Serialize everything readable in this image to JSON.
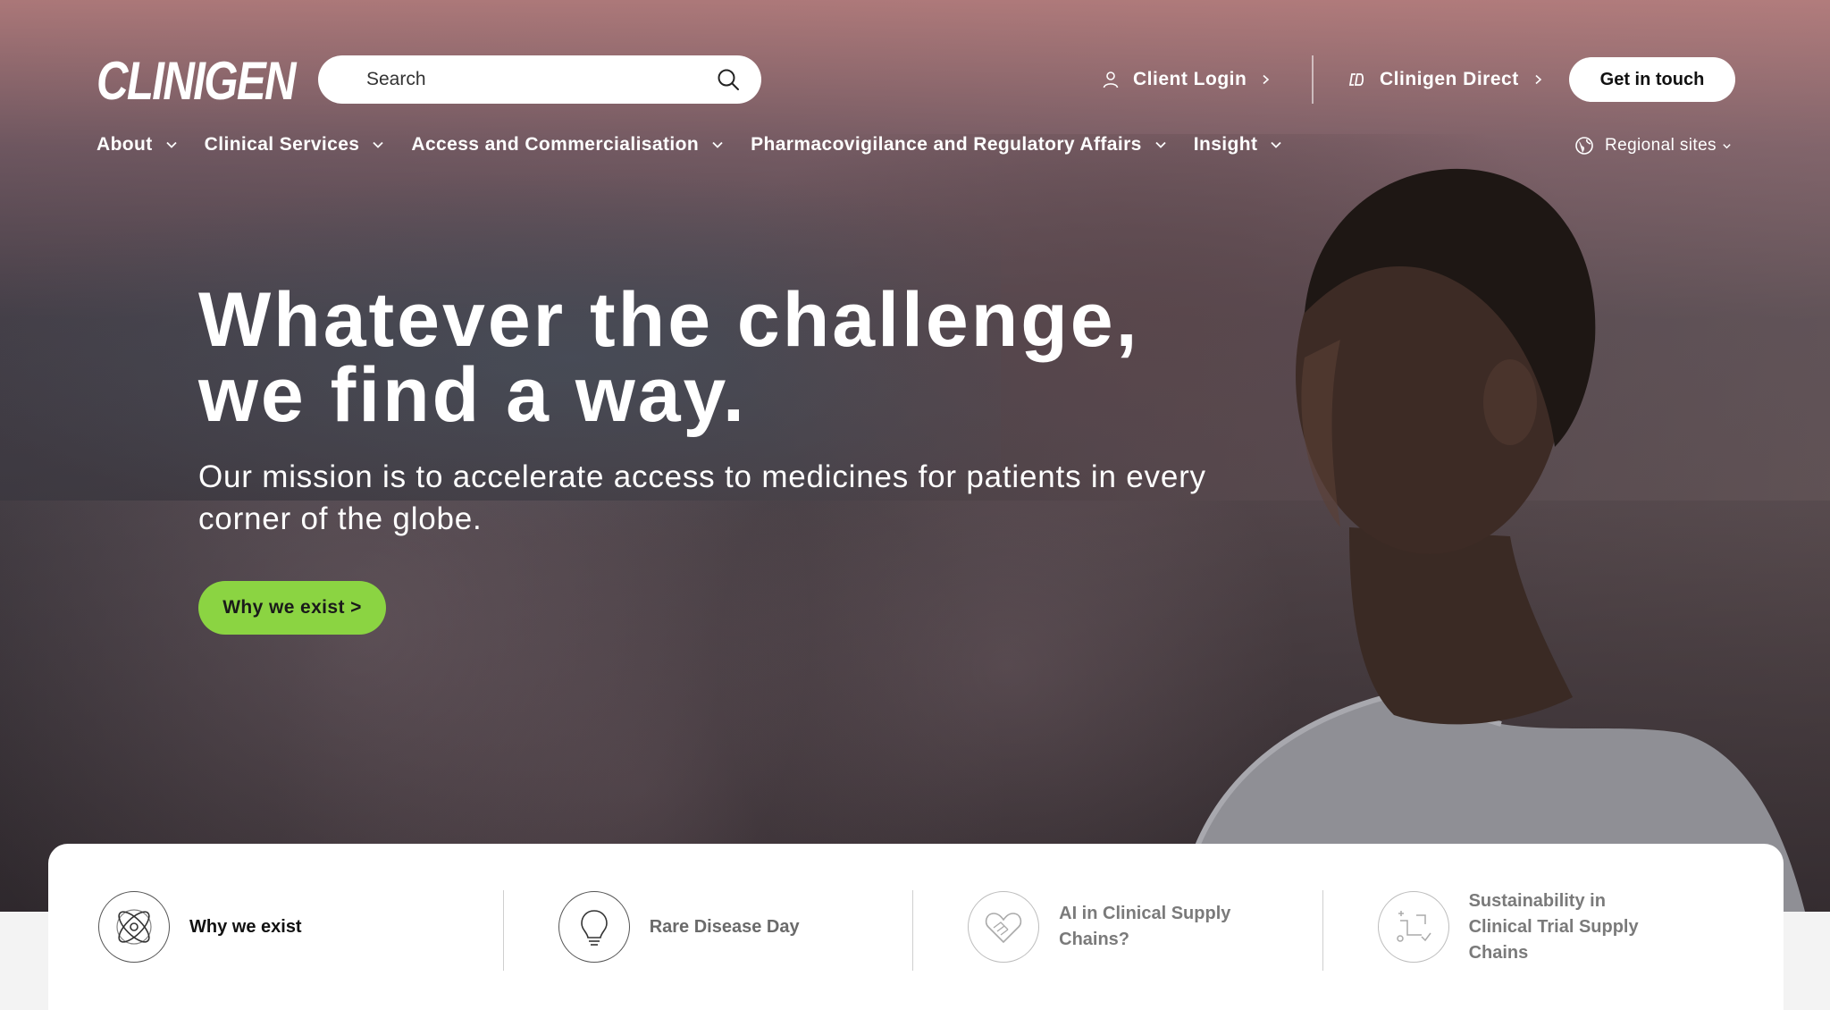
{
  "header": {
    "logo_text": "CLINIGEN",
    "search_placeholder": "Search",
    "client_login_label": "Client Login",
    "clinigen_direct_label": "Clinigen Direct",
    "get_in_touch_label": "Get in touch"
  },
  "nav": {
    "items": [
      {
        "label": "About"
      },
      {
        "label": "Clinical Services"
      },
      {
        "label": "Access and Commercialisation"
      },
      {
        "label": "Pharmacovigilance and Regulatory Affairs"
      },
      {
        "label": "Insight"
      }
    ],
    "regional_label": "Regional sites"
  },
  "hero": {
    "headline_line1": "Whatever the challenge,",
    "headline_line2": "we find a way.",
    "subhead": "Our mission is to accelerate access to medicines for patients in every corner of the globe.",
    "cta_label": "Why we exist >"
  },
  "cards": [
    {
      "label": "Why we exist",
      "icon": "atom-icon"
    },
    {
      "label": "Rare Disease Day",
      "icon": "lightbulb-icon"
    },
    {
      "label": "AI in Clinical Supply Chains?",
      "icon": "handshake-heart-icon"
    },
    {
      "label": "Sustainability in Clinical Trial Supply Chains",
      "icon": "route-icon"
    }
  ],
  "colors": {
    "accent_green": "#8bd442",
    "text_white": "#ffffff"
  }
}
